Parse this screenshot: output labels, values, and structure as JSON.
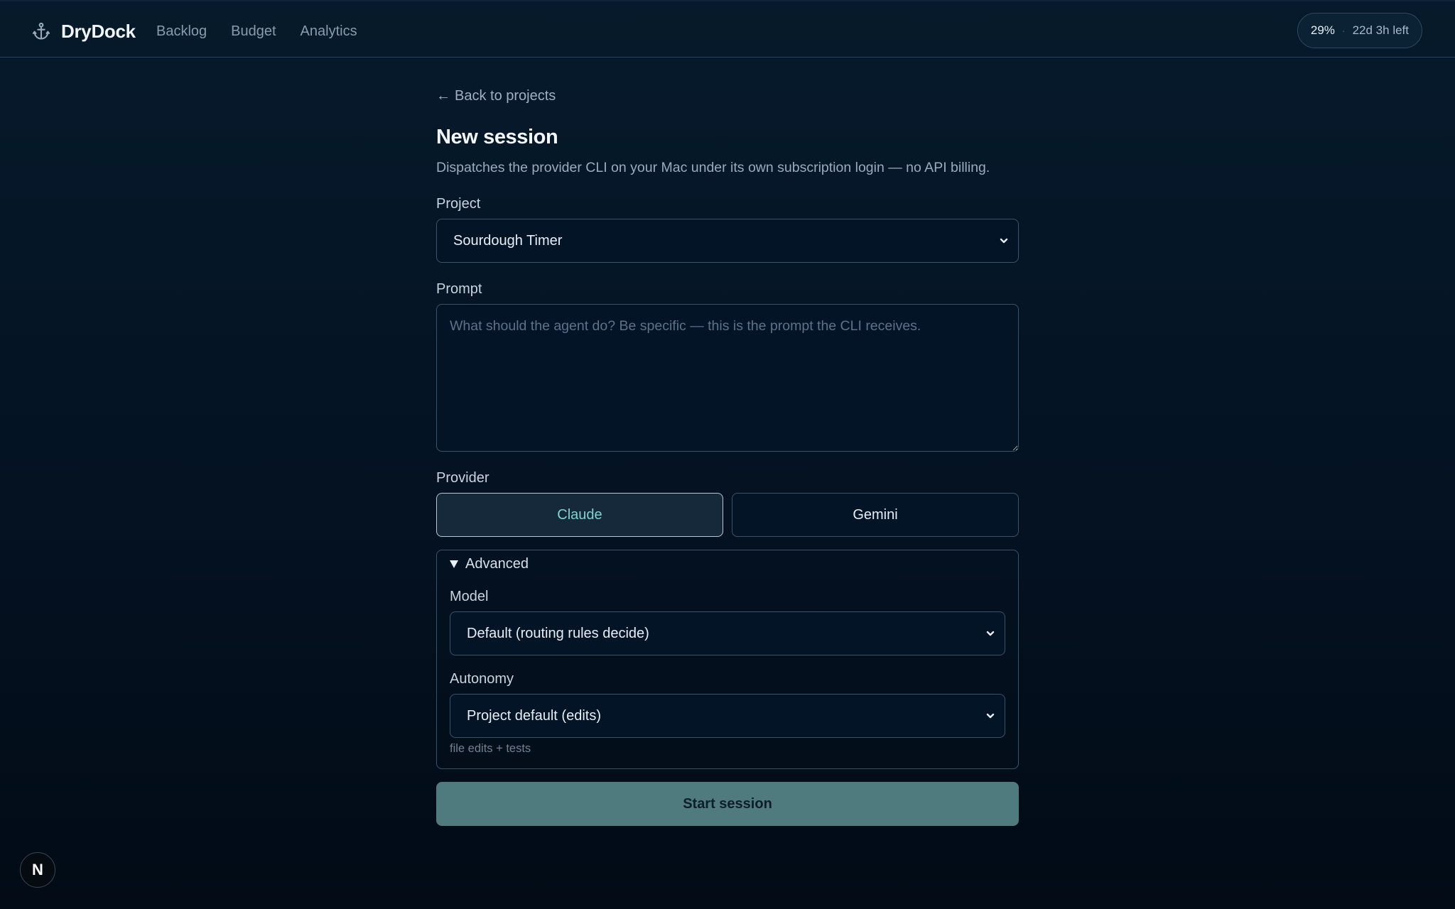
{
  "app": {
    "name": "DryDock",
    "logo_icon": "anchor-icon"
  },
  "nav": {
    "items": [
      {
        "label": "Backlog"
      },
      {
        "label": "Budget"
      },
      {
        "label": "Analytics"
      }
    ]
  },
  "usage": {
    "percent": "29%",
    "separator": "·",
    "time_left": "22d 3h left"
  },
  "page": {
    "back_label": "Back to projects",
    "title": "New session",
    "description": "Dispatches the provider CLI on your Mac under its own subscription login — no API billing."
  },
  "form": {
    "project": {
      "label": "Project",
      "value": "Sourdough Timer"
    },
    "prompt": {
      "label": "Prompt",
      "placeholder": "What should the agent do? Be specific — this is the prompt the CLI receives.",
      "value": ""
    },
    "provider": {
      "label": "Provider",
      "options": [
        {
          "label": "Claude",
          "selected": true
        },
        {
          "label": "Gemini",
          "selected": false
        }
      ]
    },
    "advanced": {
      "label": "Advanced",
      "expanded": true,
      "model": {
        "label": "Model",
        "value": "Default (routing rules decide)"
      },
      "autonomy": {
        "label": "Autonomy",
        "value": "Project default (edits)",
        "hint": "file edits + tests"
      }
    },
    "submit_label": "Start session"
  },
  "dev_badge": {
    "label": "N"
  },
  "colors": {
    "background": "#041222",
    "accent_text": "#7fd3cf",
    "submit_bg": "#4f7a7e",
    "border": "#3a536a"
  }
}
